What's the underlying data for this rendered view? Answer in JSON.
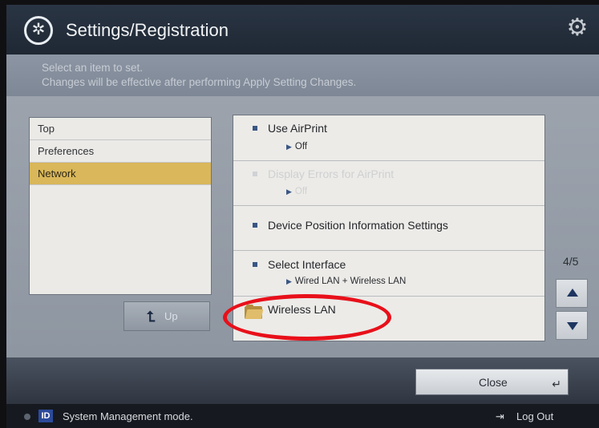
{
  "header": {
    "title": "Settings/Registration",
    "app_icon": "settings-registration-icon",
    "settings_icon": "gear-icon"
  },
  "instructions": {
    "line1": "Select an item to set.",
    "line2": "Changes will be effective after performing Apply Setting Changes."
  },
  "nav": {
    "items": [
      {
        "label": "Top",
        "active": false
      },
      {
        "label": "Preferences",
        "active": false
      },
      {
        "label": "Network",
        "active": true
      }
    ],
    "up_label": "Up"
  },
  "list": {
    "items": [
      {
        "title": "Use AirPrint",
        "value": "Off",
        "enabled": true
      },
      {
        "title": "Display Errors for AirPrint",
        "value": "Off",
        "enabled": false
      },
      {
        "title": "Device Position Information Settings",
        "value": "",
        "enabled": true
      },
      {
        "title": "Select Interface",
        "value": "Wired LAN + Wireless LAN",
        "enabled": true
      },
      {
        "title": "Wireless LAN",
        "value": "",
        "enabled": true,
        "folder": true
      }
    ]
  },
  "pager": {
    "page_indicator": "4/5"
  },
  "action_bar": {
    "close_label": "Close"
  },
  "status_bar": {
    "id_badge": "ID",
    "mode_text": "System Management mode.",
    "logout_label": "Log Out"
  },
  "colors": {
    "nav_active": "#d9b75a",
    "highlight": "#e8101a",
    "accent_blue": "#1e3560"
  }
}
